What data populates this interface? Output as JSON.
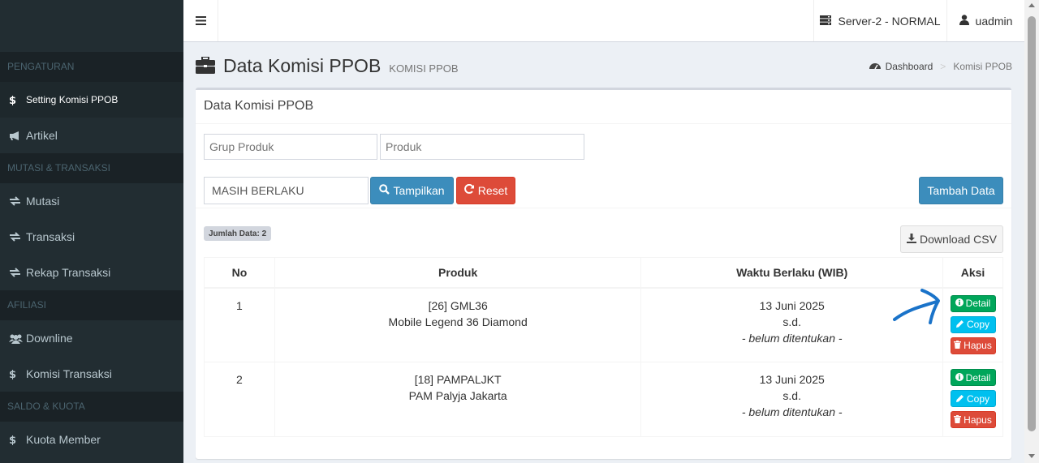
{
  "sidebar": {
    "sections": [
      {
        "header": "PENGATURAN"
      },
      {
        "header": "MUTASI & TRANSAKSI"
      },
      {
        "header": "AFILIASI"
      },
      {
        "header": "SALDO & KUOTA"
      }
    ],
    "items": [
      {
        "label": "Setting Komisi PPOB",
        "icon": "dollar-icon"
      },
      {
        "label": "Artikel",
        "icon": "bullhorn-icon"
      },
      {
        "label": "Mutasi",
        "icon": "exchange-icon"
      },
      {
        "label": "Transaksi",
        "icon": "exchange-icon"
      },
      {
        "label": "Rekap Transaksi",
        "icon": "exchange-icon"
      },
      {
        "label": "Downline",
        "icon": "users-icon"
      },
      {
        "label": "Komisi Transaksi",
        "icon": "dollar-icon"
      },
      {
        "label": "Kuota Member",
        "icon": "dollar-icon"
      }
    ]
  },
  "topbar": {
    "server_label": "Server-2 - NORMAL",
    "user_label": "uadmin"
  },
  "page": {
    "title": "Data Komisi PPOB",
    "subtitle": "KOMISI PPOB",
    "breadcrumb": {
      "home": "Dashboard",
      "current": "Komisi PPOB"
    }
  },
  "box": {
    "title": "Data Komisi PPOB",
    "filters": {
      "grup_produk_placeholder": "Grup Produk",
      "produk_placeholder": "Produk",
      "status_value": "MASIH BERLAKU"
    },
    "buttons": {
      "tampilkan": "Tampilkan",
      "reset": "Reset",
      "tambah": "Tambah Data",
      "download": "Download CSV"
    },
    "jumlah_data": "Jumlah Data: 2"
  },
  "table": {
    "headers": [
      "No",
      "Produk",
      "Waktu Berlaku (WIB)",
      "Aksi"
    ],
    "rows": [
      {
        "no": "1",
        "produk_code": "[26] GML36",
        "produk_name": "Mobile Legend 36 Diamond",
        "start": "13 Juni 2025",
        "sd": "s.d.",
        "end": "- belum ditentukan -"
      },
      {
        "no": "2",
        "produk_code": "[18] PAMPALJKT",
        "produk_name": "PAM Palyja Jakarta",
        "start": "13 Juni 2025",
        "sd": "s.d.",
        "end": "- belum ditentukan -"
      }
    ],
    "actions": {
      "detail": "Detail",
      "copy": "Copy",
      "hapus": "Hapus"
    }
  },
  "colors": {
    "sidebar_bg": "#222d32",
    "primary": "#3c8dbc",
    "danger": "#dd4b39",
    "success": "#00a65a",
    "info": "#00c0ef",
    "annotation": "#1a73c9"
  }
}
